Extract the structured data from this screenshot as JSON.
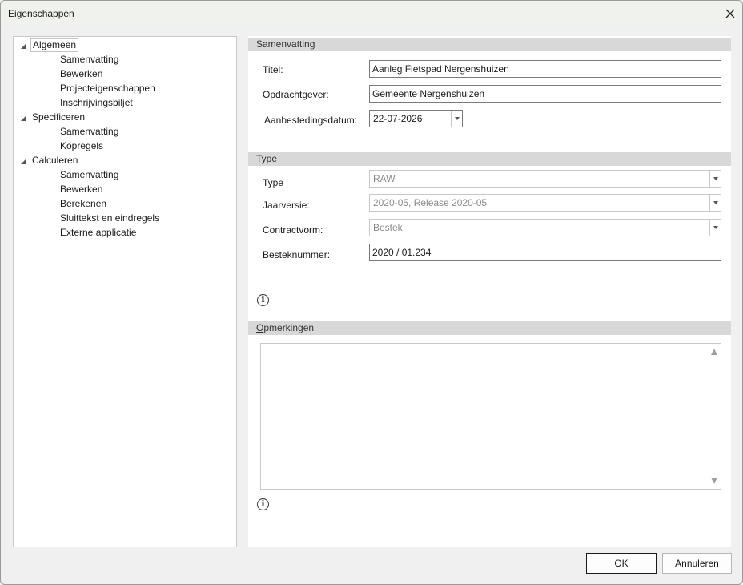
{
  "window": {
    "title": "Eigenschappen"
  },
  "tree": {
    "groups": [
      {
        "label": "Algemeen",
        "children": [
          "Samenvatting",
          "Bewerken",
          "Projecteigenschappen",
          "Inschrijvingsbiljet"
        ]
      },
      {
        "label": "Specificeren",
        "children": [
          "Samenvatting",
          "Kopregels"
        ]
      },
      {
        "label": "Calculeren",
        "children": [
          "Samenvatting",
          "Bewerken",
          "Berekenen",
          "Sluittekst en eindregels",
          "Externe applicatie"
        ]
      }
    ],
    "selected": "Algemeen"
  },
  "summary": {
    "header": "Samenvatting",
    "title_label": "Titel:",
    "title_value": "Aanleg Fietspad Nergenshuizen",
    "client_label": "Opdrachtgever:",
    "client_value": "Gemeente Nergenshuizen",
    "date_label": "Aanbestedingsdatum:",
    "date_value": "22-07-2026"
  },
  "type_section": {
    "header": "Type",
    "type_label": "Type",
    "type_value": "RAW",
    "version_label": "Jaarversie:",
    "version_value": "2020-05, Release 2020-05",
    "contract_label": "Contractvorm:",
    "contract_value": "Bestek",
    "number_label": "Besteknummer:",
    "number_value": "2020 / 01.234"
  },
  "remarks": {
    "header_first": "O",
    "header_rest": "pmerkingen",
    "value": ""
  },
  "buttons": {
    "ok": "OK",
    "cancel": "Annuleren"
  },
  "icons": {
    "close": "close-icon",
    "info": "info-icon",
    "expand": "expanded-arrow-icon"
  }
}
